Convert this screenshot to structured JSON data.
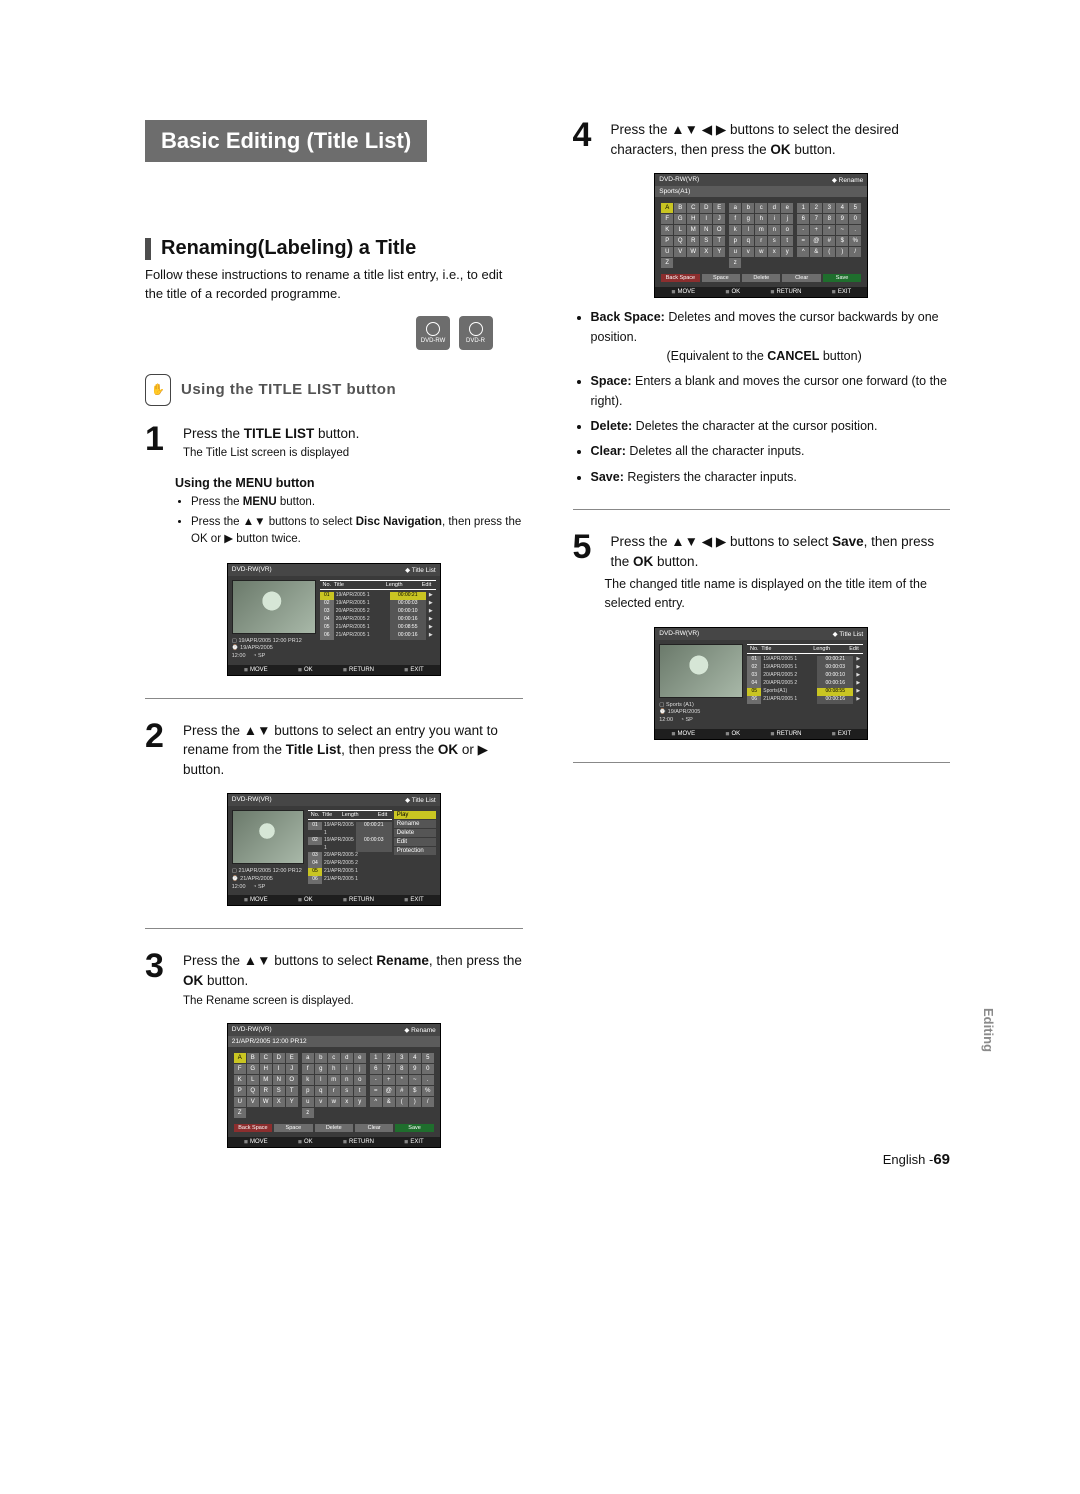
{
  "chapter_title": "Basic Editing (Title List)",
  "section_title": "Renaming(Labeling) a Title",
  "intro": "Follow these instructions to rename a title list entry, i.e., to edit the title of a recorded programme.",
  "disc_types": [
    "DVD-RW",
    "DVD-R"
  ],
  "subheading": "Using the TITLE LIST button",
  "hand_label": "✋",
  "step1": {
    "main_a": "Press the ",
    "main_bold": "TITLE LIST",
    "main_b": " button.",
    "sub": "The Title List screen is displayed"
  },
  "menu_heading": "Using the MENU button",
  "menu_bullets": [
    {
      "pre": "Press the ",
      "bold": "MENU",
      "post": " button."
    },
    {
      "pre": "Press the ▲▼ buttons to select ",
      "bold": "Disc Navigation",
      "post": ", then press the OK or ▶ button twice."
    }
  ],
  "step2": {
    "text_a": "Press the ▲▼ buttons to select an entry you want to rename from the ",
    "bold": "Title List",
    "text_b": ", then press the ",
    "bold2": "OK",
    "text_c": " or ▶ button."
  },
  "step3": {
    "text_a": "Press the ▲▼ buttons to select ",
    "bold": "Rename",
    "text_b": ", then press the ",
    "bold2": "OK",
    "text_c": " button.",
    "sub": "The Rename screen is displayed."
  },
  "step4": {
    "text_a": "Press the ▲▼ ◀ ▶ buttons to select the desired characters, then press the ",
    "bold": "OK",
    "text_b": " button."
  },
  "key_defs": [
    {
      "term": "Back Space:",
      "def_a": "Deletes and moves the cursor backwards by one position.",
      "def_b": "(Equivalent to the ",
      "def_bold": "CANCEL",
      "def_c": " button)"
    },
    {
      "term": "Space:",
      "def_a": "Enters a blank and moves the cursor one forward (to the right)."
    },
    {
      "term": "Delete:",
      "def_a": "Deletes the character at the cursor position."
    },
    {
      "term": "Clear:",
      "def_a": "Deletes all the character inputs."
    },
    {
      "term": "Save:",
      "def_a": "Registers the character inputs."
    }
  ],
  "step5": {
    "text_a": "Press the ▲▼ ◀ ▶ buttons to select ",
    "bold": "Save",
    "text_b": ", then press the ",
    "bold2": "OK",
    "text_c": " button.",
    "result": "The changed title name is displayed on the title item of the selected entry."
  },
  "osd": {
    "disc_mode": "DVD-RW(VR)",
    "title_list": "Title List",
    "rename": "Rename",
    "cols": {
      "no": "No.",
      "title": "Title",
      "length": "Length",
      "edit": "Edit"
    },
    "rows": [
      {
        "idx": "01",
        "title": "19/APR/2005 1",
        "len": "00:00:21"
      },
      {
        "idx": "02",
        "title": "19/APR/2005 1",
        "len": "00:00:03"
      },
      {
        "idx": "03",
        "title": "20/APR/2005 2",
        "len": "00:00:10"
      },
      {
        "idx": "04",
        "title": "20/APR/2005 2",
        "len": "00:00:16"
      },
      {
        "idx": "05",
        "title": "21/APR/2005 1",
        "len": "00:08:55"
      },
      {
        "idx": "06",
        "title": "21/APR/2005 1",
        "len": "00:00:16"
      }
    ],
    "preview1": {
      "line1": "19/APR/2005 12:00 PR12",
      "line2": "19/APR/2005",
      "line3": "12:00",
      "qual": "SP"
    },
    "preview2": {
      "line1": "21/APR/2005 12:00 PR12",
      "line2": "21/APR/2005",
      "line3": "12:00",
      "qual": "SP"
    },
    "preview5": {
      "line1": "Sports (A1)",
      "line2": "19/APR/2005",
      "line3": "12:00",
      "qual": "SP"
    },
    "rows5_extra": {
      "idx": "05",
      "title": "Sports(A1)",
      "len": "00:08:55"
    },
    "popup": [
      "Play",
      "Rename",
      "Delete",
      "Edit",
      "Protection"
    ],
    "foot": {
      "move": "MOVE",
      "ok": "OK",
      "ret": "RETURN",
      "exit": "EXIT"
    },
    "rename_header_1": "21/APR/2005 12:00 PR12",
    "rename_header_2": "Sports(A1)",
    "kbd_upper": [
      "A",
      "B",
      "C",
      "D",
      "E",
      "F",
      "G",
      "H",
      "I",
      "J",
      "K",
      "L",
      "M",
      "N",
      "O",
      "P",
      "Q",
      "R",
      "S",
      "T",
      "U",
      "V",
      "W",
      "X",
      "Y",
      "Z"
    ],
    "kbd_lower": [
      "a",
      "b",
      "c",
      "d",
      "e",
      "f",
      "g",
      "h",
      "i",
      "j",
      "k",
      "l",
      "m",
      "n",
      "o",
      "p",
      "q",
      "r",
      "s",
      "t",
      "u",
      "v",
      "w",
      "x",
      "y",
      "z"
    ],
    "kbd_sym": [
      "1",
      "2",
      "3",
      "4",
      "5",
      "6",
      "7",
      "8",
      "9",
      "0",
      "-",
      "+",
      "*",
      "~",
      ".",
      "=",
      "@",
      "#",
      "$",
      "%",
      "^",
      "&",
      "(",
      ")",
      "/"
    ],
    "kbd_controls": [
      "Back Space",
      "Space",
      "Delete",
      "Clear",
      "Save"
    ]
  },
  "side_tab": "Editing",
  "footer_lang": "English -",
  "footer_page": "69"
}
